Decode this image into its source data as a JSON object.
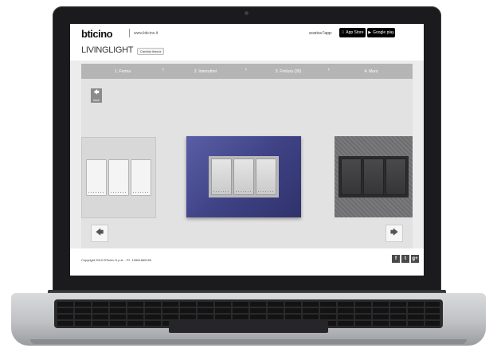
{
  "header": {
    "logo": "bticino",
    "site_url": "www.bticino.it",
    "download_label": "scarica l'app:",
    "app_store_label": "App Store",
    "google_play_label": "Google play"
  },
  "brand": {
    "title": "LIVINGLIGHT",
    "range_button": "Cambia linea ▸"
  },
  "steps": [
    {
      "label": "1. Forma"
    },
    {
      "label": "2. Interruttori"
    },
    {
      "label": "3. Finitura (30)"
    },
    {
      "label": "4. Muro"
    }
  ],
  "stage": {
    "back_label": "back",
    "plates": [
      {
        "finish": "white"
      },
      {
        "finish": "blue"
      },
      {
        "finish": "steel"
      }
    ]
  },
  "footer": {
    "copyright": "Copyright 2012 BTicino S.p.A. - P.I. 10961660150",
    "social": [
      "f",
      "t",
      "g+"
    ]
  },
  "colors": {
    "plate_blue": "#4a4f95",
    "step_bar": "#b5b5b5",
    "bezel": "#1b1b1d"
  }
}
